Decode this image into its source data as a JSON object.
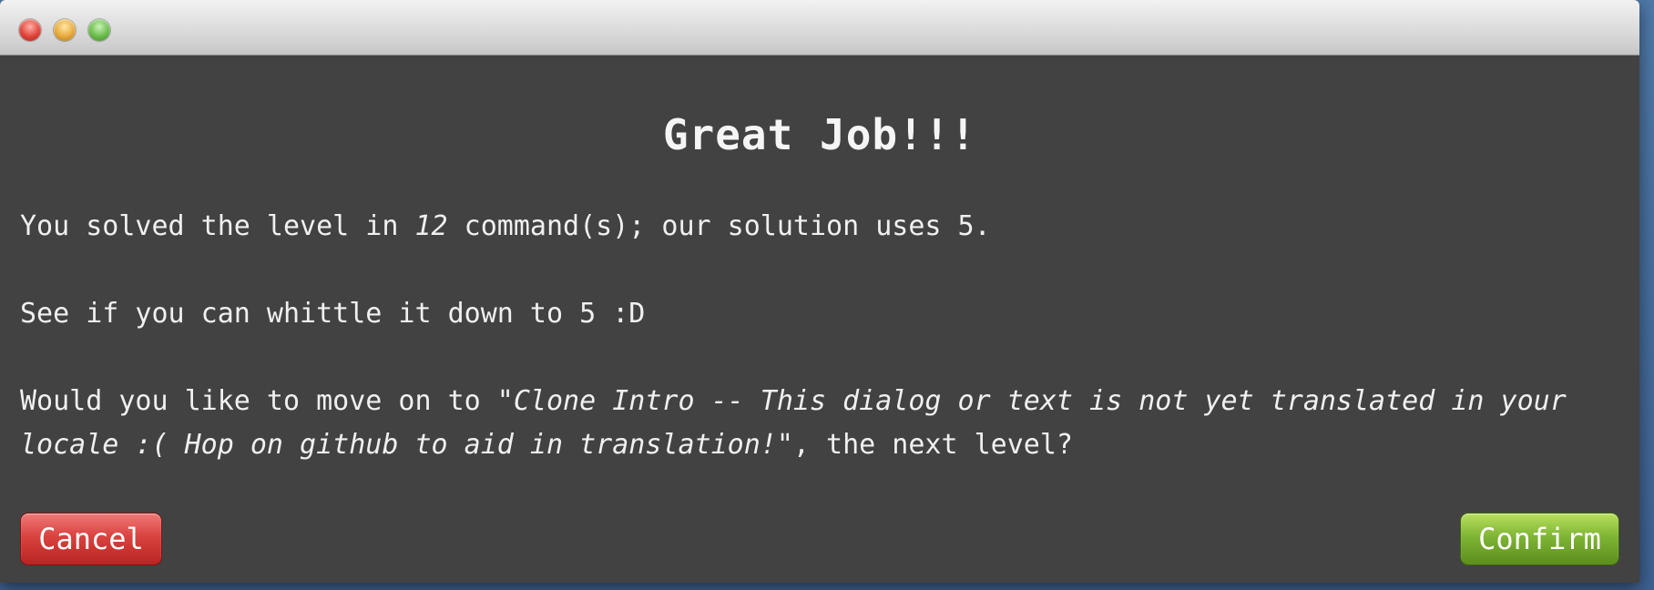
{
  "window": {
    "controls": [
      "close",
      "minimize",
      "maximize"
    ]
  },
  "dialog": {
    "title": "Great Job!!!",
    "line1": {
      "prefix": "You solved the level in ",
      "count": "12",
      "suffix": " command(s); our solution uses 5."
    },
    "line2": "See if you can whittle it down to 5 :D",
    "line3": {
      "prefix": "Would you like to move on to \"",
      "level_name": "Clone Intro -- This dialog or text is not yet translated in your locale :( Hop on github to aid in translation!",
      "suffix": "\", the next level?"
    },
    "cancel_label": "Cancel",
    "confirm_label": "Confirm"
  },
  "colors": {
    "dialog_bg": "#424242",
    "cancel": "#d9423f",
    "confirm": "#7fb534"
  }
}
